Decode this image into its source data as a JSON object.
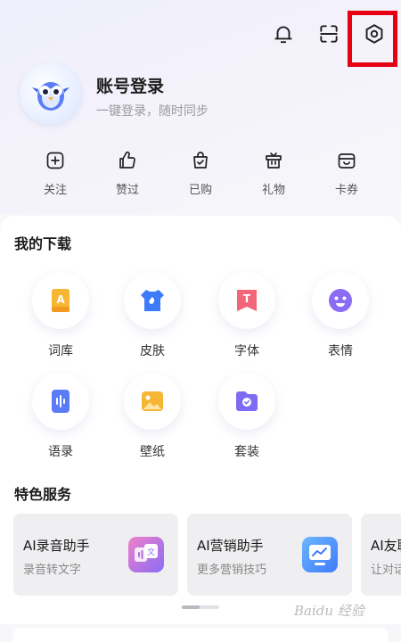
{
  "topbar": {
    "icons": [
      "bell-icon",
      "scan-icon",
      "settings-icon"
    ],
    "highlight_color": "#e60012"
  },
  "profile": {
    "name": "账号登录",
    "subtitle": "一键登录，随时同步"
  },
  "quick_actions": [
    {
      "label": "关注",
      "icon": "plus-square-icon"
    },
    {
      "label": "赞过",
      "icon": "thumbs-up-icon"
    },
    {
      "label": "已购",
      "icon": "shopping-bag-icon"
    },
    {
      "label": "礼物",
      "icon": "gift-icon"
    },
    {
      "label": "卡券",
      "icon": "coupon-icon"
    }
  ],
  "downloads": {
    "title": "我的下载",
    "items": [
      {
        "label": "词库",
        "icon": "lexicon-icon",
        "color": "#f7b733"
      },
      {
        "label": "皮肤",
        "icon": "skin-icon",
        "color": "#3e7bfa"
      },
      {
        "label": "字体",
        "icon": "font-icon",
        "color": "#f2667a"
      },
      {
        "label": "表情",
        "icon": "emoji-icon",
        "color": "#8a6cf5"
      },
      {
        "label": "语录",
        "icon": "quotes-icon",
        "color": "#5b7cf7"
      },
      {
        "label": "壁纸",
        "icon": "wallpaper-icon",
        "color": "#f5b634"
      },
      {
        "label": "套装",
        "icon": "bundle-icon",
        "color": "#7d6cf3"
      }
    ]
  },
  "services": {
    "title": "特色服务",
    "items": [
      {
        "title": "AI录音助手",
        "subtitle": "录音转文字",
        "icon": "voice-translate-icon"
      },
      {
        "title": "AI营销助手",
        "subtitle": "更多营销技巧",
        "icon": "marketing-chart-icon"
      },
      {
        "title": "AI友聊",
        "subtitle": "让对话",
        "icon": "chat-icon"
      }
    ]
  },
  "watermark": "Baidu 经验"
}
